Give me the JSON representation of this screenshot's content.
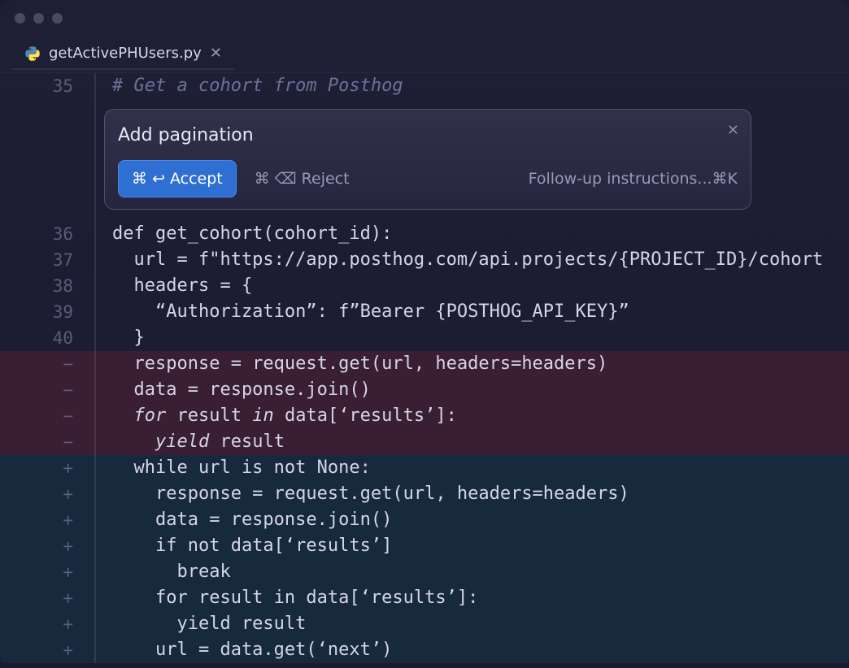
{
  "tab": {
    "filename": "getActivePHUsers.py"
  },
  "popup": {
    "title": "Add pagination",
    "accept_shortcut": "⌘ ↩",
    "accept_label": "Accept",
    "reject_shortcut": "⌘ ⌫",
    "reject_label": "Reject",
    "followup": "Follow-up instructions...⌘K"
  },
  "lines": [
    {
      "num": "35",
      "diff": "",
      "text": "# Get a cohort from Posthog",
      "cls": "comment"
    },
    {
      "num": "36",
      "diff": "",
      "text": "def get_cohort(cohort_id):"
    },
    {
      "num": "37",
      "diff": "",
      "text": "  url = f\"https://app.posthog.com/api.projects/{PROJECT_ID}/cohort"
    },
    {
      "num": "38",
      "diff": "",
      "text": "  headers = {"
    },
    {
      "num": "39",
      "diff": "",
      "text": "    “Authorization”: f”Bearer {POSTHOG_API_KEY}”"
    },
    {
      "num": "40",
      "diff": "",
      "text": "  }"
    },
    {
      "num": "−",
      "diff": "removed",
      "text": "  response = request.get(url, headers=headers)"
    },
    {
      "num": "−",
      "diff": "removed",
      "text": "  data = response.join()"
    },
    {
      "num": "−",
      "diff": "removed",
      "html": "  <span class='kw'>for</span> result <span class='kw'>in</span> data[‘results’]:"
    },
    {
      "num": "−",
      "diff": "removed",
      "html": "    <span class='kw'>yield</span> result"
    },
    {
      "num": "+",
      "diff": "added",
      "text": "  while url is not None:"
    },
    {
      "num": "+",
      "diff": "added",
      "text": "    response = request.get(url, headers=headers)"
    },
    {
      "num": "+",
      "diff": "added",
      "text": "    data = response.join()"
    },
    {
      "num": "+",
      "diff": "added",
      "text": "    if not data[‘results’]"
    },
    {
      "num": "+",
      "diff": "added",
      "text": "      break"
    },
    {
      "num": "+",
      "diff": "added",
      "text": "    for result in data[‘results’]:"
    },
    {
      "num": "+",
      "diff": "added",
      "text": "      yield result"
    },
    {
      "num": "+",
      "diff": "added",
      "text": "    url = data.get(‘next’)"
    }
  ]
}
